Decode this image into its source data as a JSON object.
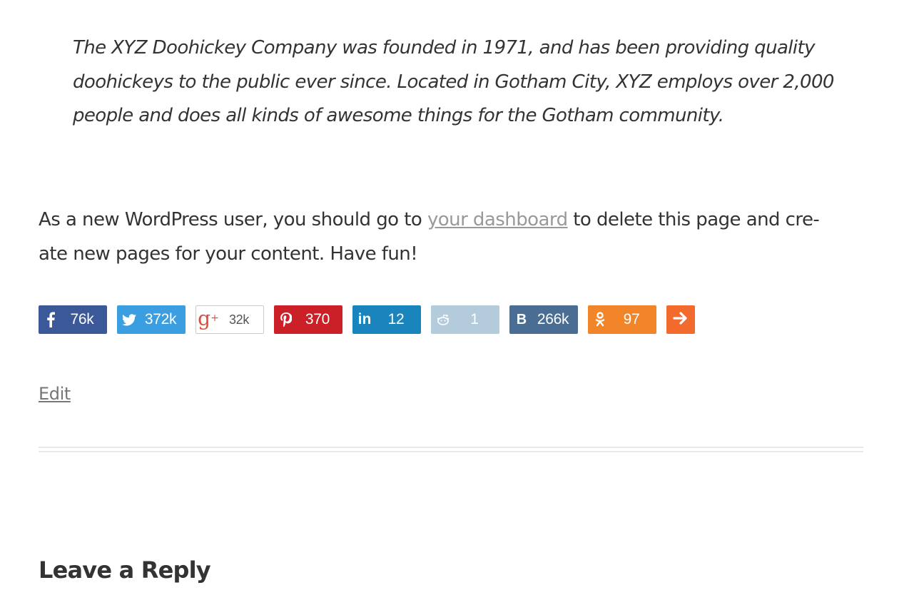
{
  "quote": {
    "lines": [
      "The XYZ Doohickey Company was founded in 1971, and has been providing quality",
      "doohickeys to the public ever since. Located in Gotham City, XYZ employs over 2,000",
      "people and does all kinds of awesome things for the Gotham community."
    ]
  },
  "intro": {
    "before_link": "As a new WordPress user, you should go to ",
    "link_text": "your dashboard",
    "after_link": " to delete this page and cre-",
    "line2": "ate new pages for your content. Have fun!"
  },
  "share": {
    "buttons": [
      {
        "network": "facebook",
        "icon": "facebook-icon",
        "count": "76k",
        "color": "#3b5998"
      },
      {
        "network": "twitter",
        "icon": "twitter-icon",
        "count": "372k",
        "color": "#3a9ee0"
      },
      {
        "network": "google-plus",
        "icon": "google-plus-icon",
        "count": "32k",
        "color": "#ffffff"
      },
      {
        "network": "pinterest",
        "icon": "pinterest-icon",
        "count": "370",
        "color": "#cb2027"
      },
      {
        "network": "linkedin",
        "icon": "linkedin-icon",
        "count": "12",
        "color": "#1a84bc"
      },
      {
        "network": "reddit",
        "icon": "reddit-icon",
        "count": "1",
        "color": "#b4cbdc"
      },
      {
        "network": "vk",
        "icon": "vk-icon",
        "count": "266k",
        "color": "#4a6d93"
      },
      {
        "network": "odnoklassniki",
        "icon": "odnoklassniki-icon",
        "count": "97",
        "color": "#f2852a"
      }
    ],
    "more": {
      "icon": "arrow-right-icon",
      "color": "#f26a2d"
    }
  },
  "edit": {
    "label": "Edit"
  },
  "comments": {
    "title": "Leave a Reply"
  }
}
